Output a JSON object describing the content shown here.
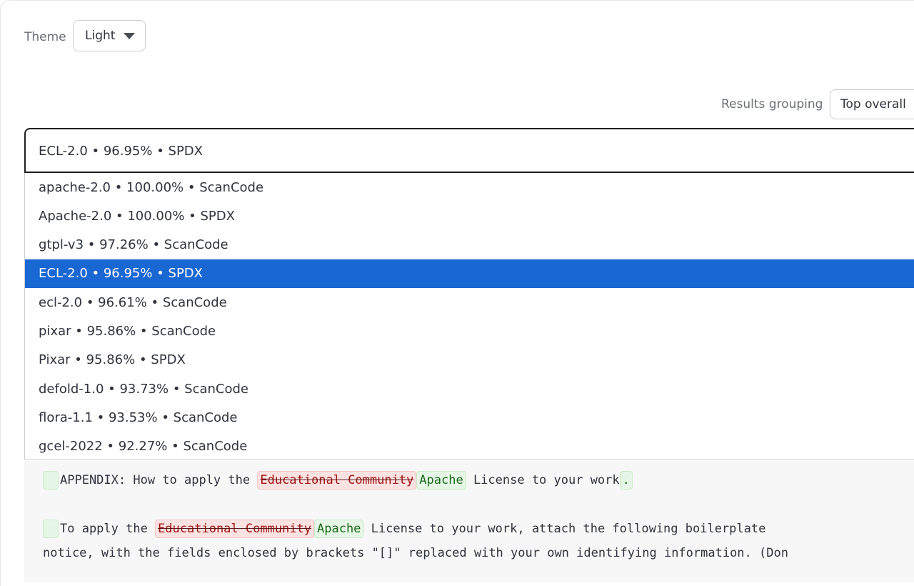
{
  "theme": {
    "label": "Theme",
    "value": "Light"
  },
  "grouping": {
    "label": "Results grouping",
    "value": "Top overall"
  },
  "combo": {
    "value": "ECL-2.0 • 96.95% • SPDX"
  },
  "options": [
    {
      "label": "apache-2.0 • 100.00% • ScanCode",
      "selected": false
    },
    {
      "label": "Apache-2.0 • 100.00% • SPDX",
      "selected": false
    },
    {
      "label": "gtpl-v3 • 97.26% • ScanCode",
      "selected": false
    },
    {
      "label": "ECL-2.0 • 96.95% • SPDX",
      "selected": true
    },
    {
      "label": "ecl-2.0 • 96.61% • ScanCode",
      "selected": false
    },
    {
      "label": "pixar • 95.86% • ScanCode",
      "selected": false
    },
    {
      "label": "Pixar • 95.86% • SPDX",
      "selected": false
    },
    {
      "label": "defold-1.0 • 93.73% • ScanCode",
      "selected": false
    },
    {
      "label": "flora-1.1 • 93.53% • ScanCode",
      "selected": false
    },
    {
      "label": "gcel-2022 • 92.27% • ScanCode",
      "selected": false
    }
  ],
  "diff": {
    "line1": {
      "pre": "APPENDIX: How to apply the ",
      "del": "Educational Community",
      "ins": "Apache",
      "post": " License to your work",
      "ins_end": "."
    },
    "line2": {
      "pre": "To apply the ",
      "del": "Educational Community",
      "ins": "Apache",
      "post": " License to your work, attach the following boilerplate"
    },
    "line3": {
      "text": "notice, with the fields enclosed by brackets \"[]\" replaced with your own identifying information. (Don"
    }
  },
  "colors": {
    "selected_bg": "#1967d2",
    "insert_bg": "#e6f6e6",
    "delete_bg": "#fde2e2"
  }
}
